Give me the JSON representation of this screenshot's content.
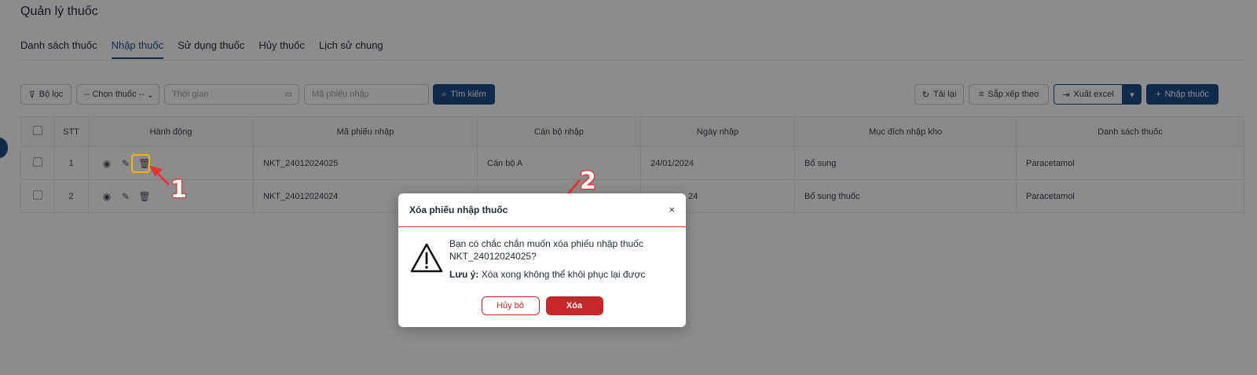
{
  "page": {
    "title": "Quản lý thuốc"
  },
  "tabs": [
    {
      "label": "Danh sách thuốc",
      "active": false
    },
    {
      "label": "Nhập thuốc",
      "active": true
    },
    {
      "label": "Sử dụng thuốc",
      "active": false
    },
    {
      "label": "Hủy thuốc",
      "active": false
    },
    {
      "label": "Lịch sử chung",
      "active": false
    }
  ],
  "toolbar": {
    "filter_label": "Bộ lọc",
    "select_drug": "-- Chọn thuốc --",
    "time_placeholder": "Thời gian",
    "receipt_placeholder": "Mã phiếu nhập",
    "search_label": "Tìm kiếm",
    "reload_label": "Tải lại",
    "sort_label": "Sắp xếp theo",
    "export_label": "Xuất excel",
    "import_label": "Nhập thuốc"
  },
  "table": {
    "headers": [
      "STT",
      "Hành động",
      "Mã phiếu nhập",
      "Cán bộ nhập",
      "Ngày nhập",
      "Mục đích nhập kho",
      "Danh sách thuốc"
    ],
    "rows": [
      {
        "stt": "1",
        "code": "NKT_24012024025",
        "staff": "Cán bộ A",
        "date": "24/01/2024",
        "purpose": "Bổ sung",
        "drugs": "Paracetamol"
      },
      {
        "stt": "2",
        "code": "NKT_24012024024",
        "staff": "",
        "date": "24",
        "purpose": "Bổ sung thuốc",
        "drugs": "Paracetamol"
      }
    ]
  },
  "annotations": {
    "marker1": "1",
    "marker2": "2"
  },
  "modal": {
    "title": "Xóa phiếu nhập thuốc",
    "close": "×",
    "message": "Bạn có chắc chắn muốn xóa phiếu nhập thuốc NKT_24012024025?",
    "note_label": "Lưu ý:",
    "note_text": " Xóa xong không thể khôi phục lại được",
    "cancel_label": "Hủy bỏ",
    "confirm_label": "Xóa"
  },
  "colors": {
    "primary": "#1d4e89",
    "danger": "#c62828",
    "highlight": "#f5b400",
    "annotation": "#e3342f"
  }
}
